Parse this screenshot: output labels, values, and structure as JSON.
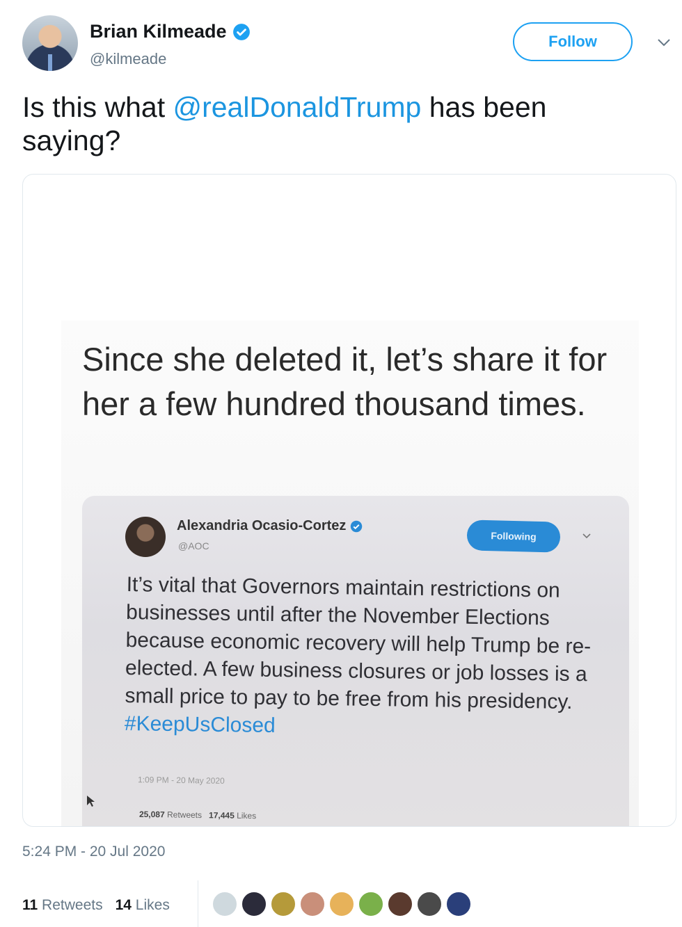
{
  "author": {
    "display_name": "Brian Kilmeade",
    "handle": "@kilmeade",
    "verified": true
  },
  "follow_button": {
    "label": "Follow"
  },
  "tweet": {
    "text_before": "Is this what ",
    "mention": "@realDonaldTrump",
    "text_after": " has been saying?"
  },
  "media": {
    "caption": "Since she deleted it, let’s share it for her a few hundred thousand times.",
    "embedded_tweet": {
      "display_name": "Alexandria Ocasio-Cortez",
      "handle": "@AOC",
      "follow_label": "Following",
      "body": "It’s vital that Governors maintain restrictions on businesses until after the November Elections because economic recovery will help Trump be re-elected. A few business closures or job losses is a small price to pay to be free from his presidency. ",
      "hashtag": "#KeepUsClosed",
      "timestamp": "1:09 PM - 20 May 2020",
      "retweets_count": "25,087",
      "retweets_label": "Retweets",
      "likes_count": "17,445",
      "likes_label": "Likes"
    }
  },
  "timestamp": "5:24 PM - 20 Jul 2020",
  "stats": {
    "retweets_count": "11",
    "retweets_label": "Retweets",
    "likes_count": "14",
    "likes_label": "Likes"
  },
  "likers": [
    {
      "icon": "default-avatar",
      "color": "#cfd9de"
    },
    {
      "icon": "flag-avatar",
      "color": "#2b2b3a"
    },
    {
      "icon": "woman-avatar",
      "color": "#b59a3a"
    },
    {
      "icon": "man-avatar",
      "color": "#c98f7a"
    },
    {
      "icon": "cross-sunset-avatar",
      "color": "#e7b25a"
    },
    {
      "icon": "badge-avatar",
      "color": "#7ab04a"
    },
    {
      "icon": "woman-dark-hair-avatar",
      "color": "#5a3a2e"
    },
    {
      "icon": "helmet-avatar",
      "color": "#4a4a4a"
    },
    {
      "icon": "stadium-avatar",
      "color": "#2a3f7a"
    }
  ],
  "colors": {
    "accent": "#1da1f2",
    "link": "#1b95e0",
    "muted": "#657786"
  }
}
